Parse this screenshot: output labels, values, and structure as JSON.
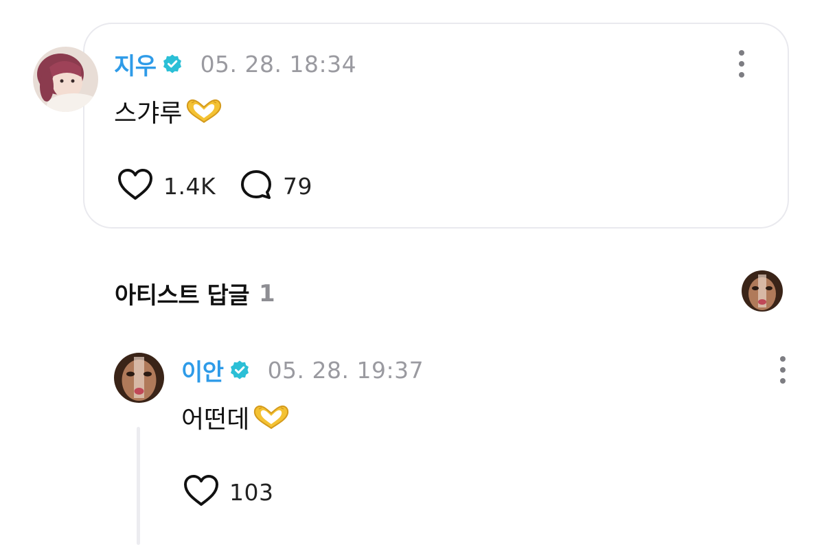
{
  "post": {
    "author": "지우",
    "timestamp": "05. 28. 18:34",
    "text": "스갸루",
    "likes": "1.4K",
    "replies": "79"
  },
  "artist_replies": {
    "title": "아티스트 답글",
    "count": "1"
  },
  "reply": {
    "author": "이안",
    "timestamp": "05. 28. 19:37",
    "text": "어떤데",
    "likes": "103"
  },
  "colors": {
    "username": "#2e9be8",
    "verified_badge": "#2bbfd6",
    "timestamp": "#9a9aa0",
    "card_border": "#e9e9ee",
    "thread_line": "#ececf0"
  },
  "icons": {
    "verified": "verified-badge-icon",
    "more": "more-vertical-icon",
    "like": "heart-icon",
    "reply": "speech-bubble-icon",
    "content_emoji": "heart-hands-emoji"
  }
}
